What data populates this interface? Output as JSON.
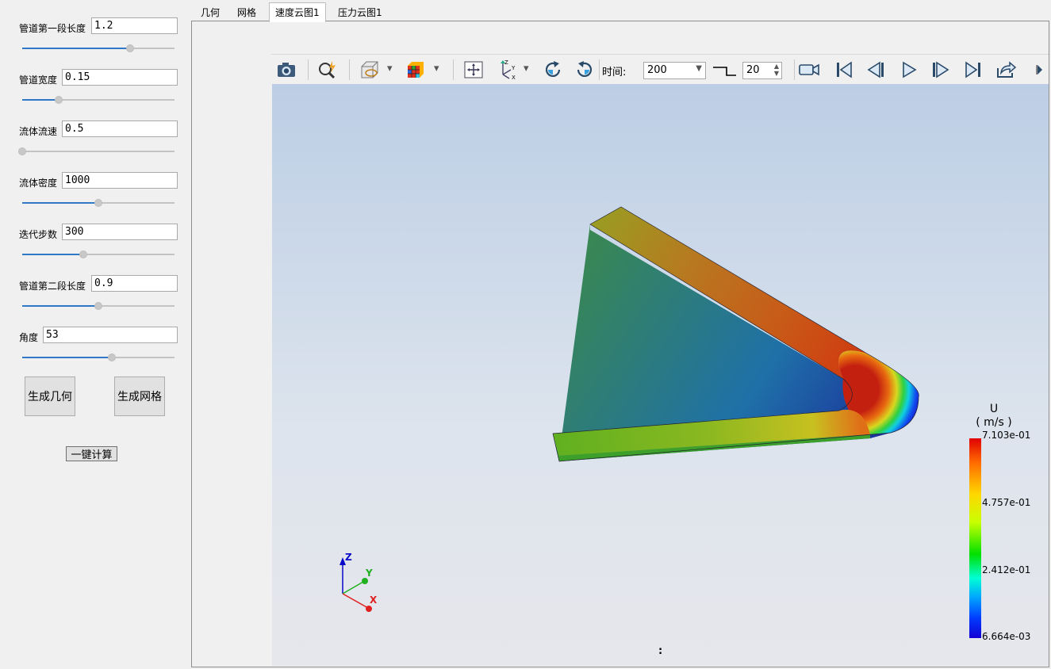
{
  "params": [
    {
      "label": "管道第一段长度",
      "value": "1.2",
      "slider": 0.71
    },
    {
      "label": "管道宽度",
      "value": "0.15",
      "slider": 0.24
    },
    {
      "label": "流体流速",
      "value": "0.5",
      "slider": 0.0
    },
    {
      "label": "流体密度",
      "value": "1000",
      "slider": 0.5
    },
    {
      "label": "迭代步数",
      "value": "300",
      "slider": 0.4
    },
    {
      "label": "管道第二段长度",
      "value": "0.9",
      "slider": 0.5
    },
    {
      "label": "角度",
      "value": "53",
      "slider": 0.59
    }
  ],
  "buttons": {
    "generate_geometry": "生成几何",
    "generate_mesh": "生成网格",
    "compute": "一键计算"
  },
  "tabs": [
    "几何",
    "网格",
    "速度云图1",
    "压力云图1"
  ],
  "active_tab": 2,
  "toolbar": {
    "time_label": "时间:",
    "time_value": "200",
    "step_value": "20"
  },
  "legend": {
    "title": "U",
    "unit": "( m/s )",
    "labels": [
      "7.103e-01",
      "4.757e-01",
      "2.412e-01",
      "6.664e-03"
    ]
  },
  "axes": {
    "z": "Z",
    "y": "Y",
    "x": "X"
  },
  "status": ":",
  "colors": {
    "accent": "#3079c6",
    "viewport_top": "#bccee5",
    "viewport_bottom": "#e6e7ec"
  }
}
